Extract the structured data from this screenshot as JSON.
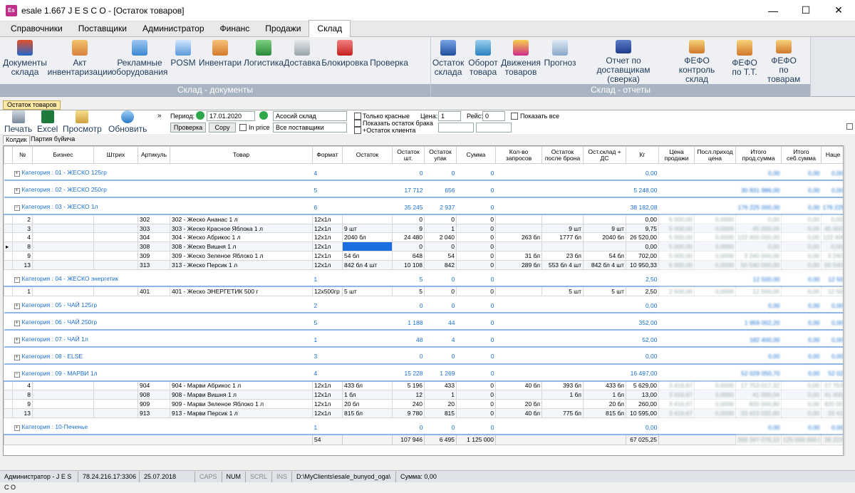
{
  "window": {
    "title": "esale 1.667   J E S C O - [Остаток товаров]",
    "icon_text": "Es"
  },
  "menu": [
    "Справочники",
    "Поставщики",
    "Администратор",
    "Финанс",
    "Продажи",
    "Склад"
  ],
  "ribbon": {
    "group1_label": "Склад - документы",
    "group1_buttons": [
      "Документы склада",
      "Акт инвентаризации",
      "Рекламные оборудования",
      "POSM",
      "Инвентари",
      "Логистика",
      "Доставка",
      "Блокировка",
      "Проверка"
    ],
    "group2_label": "Склад - отчеты",
    "group2_buttons": [
      "Остаток склада",
      "Оборот товара",
      "Движения товаров",
      "Прогноз",
      "Отчет по доставщикам (сверка)",
      "ФЕФО контроль склад",
      "ФЕФО по Т.Т.",
      "ФЕФО по товарам"
    ]
  },
  "doc_tab": "Остаток товаров",
  "toolbar": {
    "print": "Печать",
    "excel": "Excel",
    "preview": "Просмотр",
    "refresh": "Обновить",
    "period_label": "Период:",
    "period_value": "17.01.2020",
    "check_btn": "Проверка",
    "copy_btn": "Copy",
    "in_price": "In price",
    "warehouse": "Асосий склад",
    "suppliers": "Все поставщики",
    "only_red": "Только красные",
    "show_defect": "Показать остаток брака",
    "plus_client": "+Остаток клиента",
    "price_label": "Цена:",
    "price_value": "1",
    "trip_label": "Рейс:",
    "trip_value": "0",
    "show_all": "Показать все"
  },
  "subtabs": [
    "Колдик",
    "Партия бүйича"
  ],
  "table": {
    "headers": [
      "№",
      "Бизнес",
      "Штрих",
      "Артикуль",
      "Товар",
      "Формат",
      "Остаток",
      "Остаток шт.",
      "Остаток упак",
      "Сумма",
      "Кол-во запросов",
      "Остаток после брона",
      "Ост.склад + ДС",
      "Кг",
      "Цена продажи",
      "Посл.приход цена",
      "Итого прод.сумма",
      "Итого себ.сумма",
      "Наце"
    ],
    "groups": [
      {
        "label": "Категория : 01 - ЖЕСКО 125гр",
        "expanded": false,
        "count": "4",
        "sht": "0",
        "upak": "0",
        "sum": "0",
        "kg": "0,00",
        "p1": "0,00",
        "p2": "0,00",
        "p3": "0,00",
        "rows": []
      },
      {
        "label": "Категория : 02 - ЖЕСКО 250гр",
        "expanded": false,
        "count": "5",
        "sht": "17 712",
        "upak": "656",
        "sum": "0",
        "kg": "5 248,00",
        "p1": "30 831 986,00",
        "p2": "0,00",
        "p3": "0,00",
        "rows": []
      },
      {
        "label": "Категория : 03 - ЖЕСКО 1л",
        "expanded": true,
        "count": "6",
        "sht": "35 245",
        "upak": "2 937",
        "sum": "0",
        "kg": "38 182,08",
        "p1": "176 225 000,00",
        "p2": "0,00",
        "p3": "176 225",
        "rows": [
          [
            "2",
            "",
            "",
            "302",
            "302 - Жеско Ананас  1 л",
            "12x1л",
            "",
            "0",
            "0",
            "0",
            "",
            "",
            "",
            "0,00",
            "5 000,00",
            "0,0000",
            "0,00",
            "0,00",
            "0,00"
          ],
          [
            "3",
            "",
            "",
            "303",
            "303 - Жеско Красное Яблока 1 л",
            "12x1л",
            "9 шт",
            "9",
            "1",
            "0",
            "",
            "9 шт",
            "9 шт",
            "9,75",
            "5 000,00",
            "0,0000",
            "45 000,00",
            "0,00",
            "45 000"
          ],
          [
            "4",
            "",
            "",
            "304",
            "304 - Жеско Абрикос 1 л",
            "12x1л",
            "2040 бл",
            "24 480",
            "2 040",
            "0",
            "263 бл",
            "1777 бл",
            "2040 бл",
            "26 520,00",
            "5 000,00",
            "0,0000",
            "122 400 000,00",
            "0,00",
            "122 400"
          ],
          [
            "8",
            "",
            "",
            "308",
            "308 - Жеско  Вишня 1 л",
            "12x1л",
            "",
            "0",
            "0",
            "0",
            "",
            "",
            "",
            "0,00",
            "5 000,00",
            "0,0000",
            "0,00",
            "0,00",
            "0,00"
          ],
          [
            "9",
            "",
            "",
            "309",
            "309 - Жеско Зеленое Яблоко 1 л",
            "12x1л",
            "54 бл",
            "648",
            "54",
            "0",
            "31 бл",
            "23 бл",
            "54 бл",
            "702,00",
            "5 000,00",
            "0,0000",
            "3 240 000,00",
            "0,00",
            "3 240"
          ],
          [
            "13",
            "",
            "",
            "313",
            "313 - Жеско Персик 1 л",
            "12x1л",
            "842 бл 4 шт",
            "10 108",
            "842",
            "0",
            "289 бл",
            "553 бл 4 шт",
            "842 бл 4 шт",
            "10 950,33",
            "5 000,00",
            "0,0000",
            "50 540 000,00",
            "0,00",
            "50 540"
          ]
        ]
      },
      {
        "label": "Категория : 04 - ЖЕСКО энергетик",
        "expanded": true,
        "count": "1",
        "sht": "5",
        "upak": "0",
        "sum": "0",
        "kg": "2,50",
        "p1": "12 500,00",
        "p2": "0,00",
        "p3": "12 50",
        "rows": [
          [
            "1",
            "",
            "",
            "401",
            "401 - Жеско ЭНЕРГЕТИК  500 г",
            "12x500гр",
            "5 шт",
            "5",
            "0",
            "0",
            "",
            "5 шт",
            "5 шт",
            "2,50",
            "2 500,00",
            "0,0000",
            "12 500,00",
            "0,00",
            "12 50"
          ]
        ]
      },
      {
        "label": "Категория : 05 - ЧАЙ 125гр",
        "expanded": false,
        "count": "2",
        "sht": "0",
        "upak": "0",
        "sum": "0",
        "kg": "0,00",
        "p1": "0,00",
        "p2": "0,00",
        "p3": "0,00",
        "rows": []
      },
      {
        "label": "Категория : 06 - ЧАЙ 250гр",
        "expanded": false,
        "count": "5",
        "sht": "1 188",
        "upak": "44",
        "sum": "0",
        "kg": "352,00",
        "p1": "1 959 002,20",
        "p2": "0,00",
        "p3": "0,00",
        "rows": []
      },
      {
        "label": "Категория : 07 - ЧАЙ 1л",
        "expanded": false,
        "count": "1",
        "sht": "48",
        "upak": "4",
        "sum": "0",
        "kg": "52,00",
        "p1": "182 400,00",
        "p2": "0,00",
        "p3": "0,00",
        "rows": []
      },
      {
        "label": "Категория : 08 - ELSE",
        "expanded": false,
        "count": "3",
        "sht": "0",
        "upak": "0",
        "sum": "0",
        "kg": "0,00",
        "p1": "0,00",
        "p2": "0,00",
        "p3": "0,00",
        "rows": []
      },
      {
        "label": "Категория : 09 - МАРВИ 1л",
        "expanded": true,
        "count": "4",
        "sht": "15 228",
        "upak": "1 269",
        "sum": "0",
        "kg": "16 497,00",
        "p1": "52 029 050,70",
        "p2": "0,00",
        "p3": "52 02",
        "rows": [
          [
            "4",
            "",
            "",
            "904",
            "904 - Марви Абрикос 1 л",
            "12x1л",
            "433 бл",
            "5 196",
            "433",
            "0",
            "40 бл",
            "393 бл",
            "433 бл",
            "5 629,00",
            "3 416,67",
            "0,0000",
            "17 753 017,32",
            "0,00",
            "17 753"
          ],
          [
            "8",
            "",
            "",
            "908",
            "908 - Марви  Вишня 1 л",
            "12x1л",
            "1 бл",
            "12",
            "1",
            "0",
            "",
            "1 бл",
            "1 бл",
            "13,00",
            "3 416,67",
            "0,0000",
            "41 000,04",
            "0,00",
            "41 000"
          ],
          [
            "9",
            "",
            "",
            "909",
            "909 - Марви  Зеленое Яблоко 1 л",
            "12x1л",
            "20 бл",
            "240",
            "20",
            "0",
            "20 бл",
            "",
            "20 бл",
            "260,00",
            "3 416,67",
            "0,0000",
            "820 000,80",
            "0,00",
            "820 00"
          ],
          [
            "13",
            "",
            "",
            "913",
            "913 - Марви  Персик 1 л",
            "12x1л",
            "815 бл",
            "9 780",
            "815",
            "0",
            "40 бл",
            "775 бл",
            "815 бл",
            "10 595,00",
            "3 416,67",
            "0,0000",
            "33 415 032,60",
            "0,00",
            "33 41"
          ]
        ]
      },
      {
        "label": "Категория : 10-Печенье",
        "expanded": false,
        "count": "1",
        "sht": "0",
        "upak": "0",
        "sum": "0",
        "kg": "0,00",
        "p1": "0,00",
        "p2": "0,00",
        "p3": "0,00",
        "rows": []
      }
    ],
    "totals": {
      "count": "54",
      "sht": "107 946",
      "upak": "6 495",
      "sum": "1 125 000",
      "kg": "67 025,25",
      "p1": "369 347 076,10",
      "p2": "125 000 000,00",
      "p3": "38 222"
    }
  },
  "status": [
    "Администратор - J E S C O",
    "78.24.216.17:3306",
    "25.07.2018",
    "CAPS",
    "NUM",
    "SCRL",
    "INS",
    "D:\\MyClients\\esale_bunyod_oga\\",
    "Сумма: 0,00"
  ],
  "colors": {
    "accent_blue": "#1a6fd0",
    "ribbon_label": "#a9b4c2",
    "selected_cell": "#1a6fe0"
  }
}
